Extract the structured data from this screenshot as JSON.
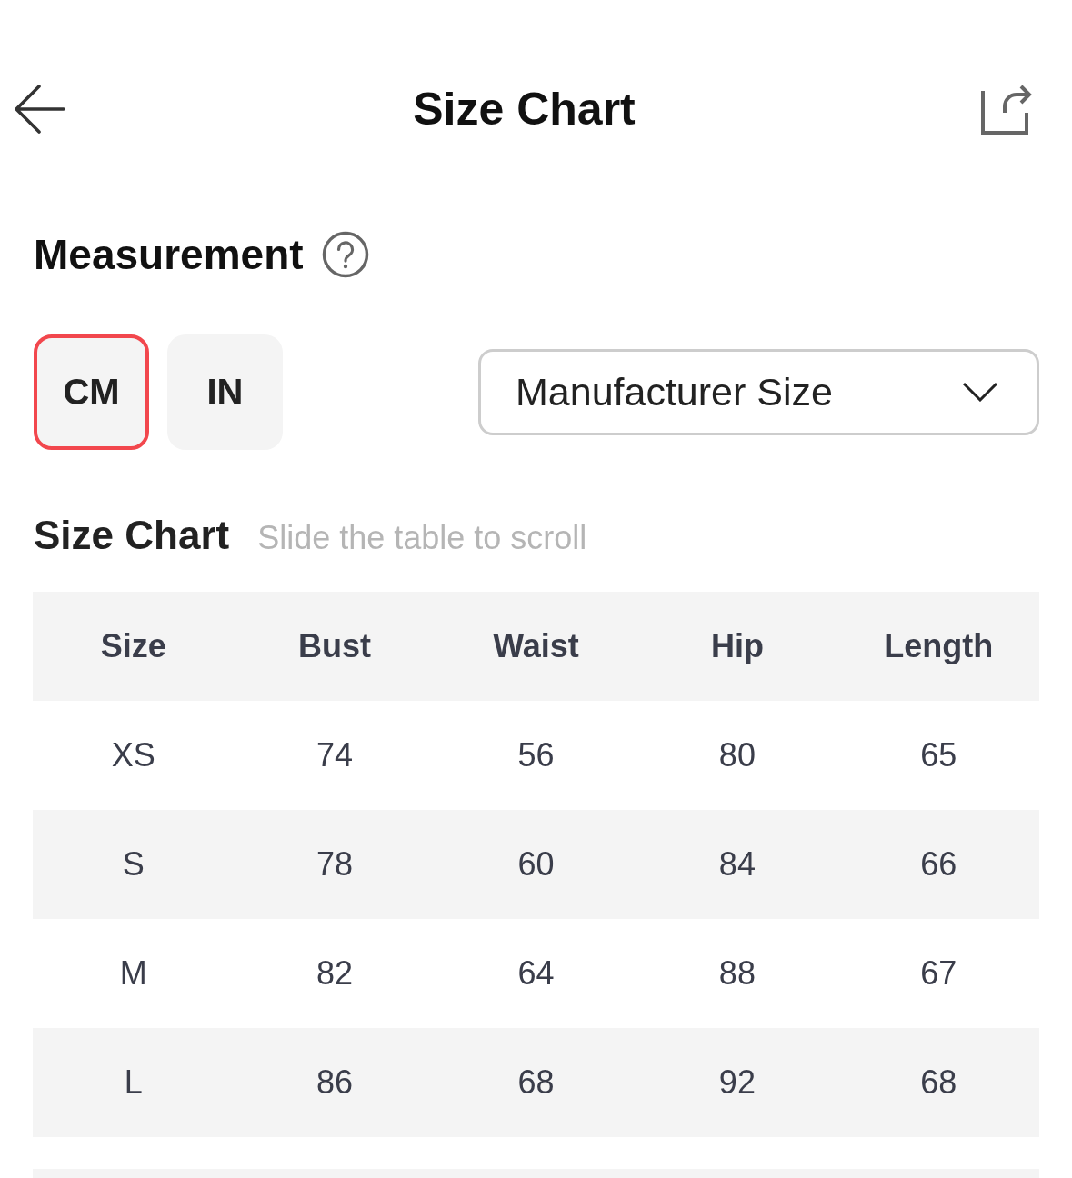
{
  "header": {
    "title": "Size Chart"
  },
  "measurement": {
    "title": "Measurement",
    "units": [
      {
        "label": "CM",
        "selected": true
      },
      {
        "label": "IN",
        "selected": false
      }
    ],
    "size_system": {
      "value": "Manufacturer Size"
    }
  },
  "size_chart": {
    "title": "Size Chart",
    "hint": "Slide the table to scroll",
    "columns": [
      "Size",
      "Bust",
      "Waist",
      "Hip",
      "Length"
    ],
    "rows": [
      [
        "XS",
        "74",
        "56",
        "80",
        "65"
      ],
      [
        "S",
        "78",
        "60",
        "84",
        "66"
      ],
      [
        "M",
        "82",
        "64",
        "88",
        "67"
      ],
      [
        "L",
        "86",
        "68",
        "92",
        "68"
      ]
    ]
  }
}
